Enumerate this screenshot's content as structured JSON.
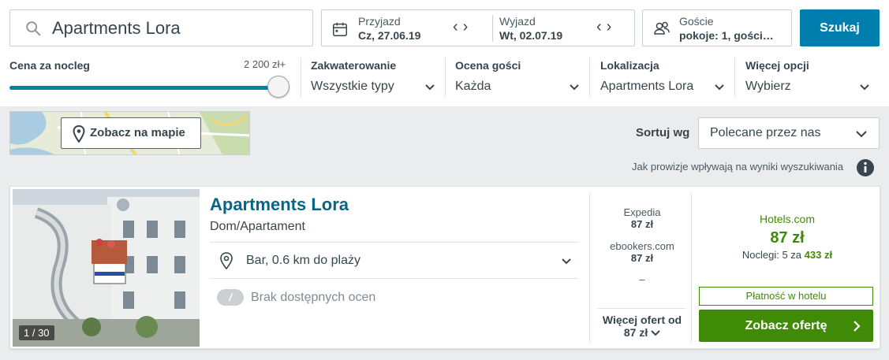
{
  "search": {
    "value": "Apartments Lora"
  },
  "dates": {
    "checkin_label": "Przyjazd",
    "checkin_value": "Cz, 27.06.19",
    "checkout_label": "Wyjazd",
    "checkout_value": "Wt, 02.07.19"
  },
  "guests": {
    "label": "Goście",
    "value": "pokoje: 1, gości…"
  },
  "search_button": "Szukaj",
  "filters": {
    "price": {
      "label": "Cena za nocleg",
      "max": "2 200 zł+",
      "level": 1.0
    },
    "accommodation": {
      "label": "Zakwaterowanie",
      "value": "Wszystkie typy"
    },
    "rating": {
      "label": "Ocena gości",
      "value": "Każda"
    },
    "location": {
      "label": "Lokalizacja",
      "value": "Apartments Lora"
    },
    "more": {
      "label": "Więcej opcji",
      "value": "Wybierz"
    }
  },
  "map": {
    "button": "Zobacz na mapie"
  },
  "sort": {
    "label": "Sortuj wg",
    "value": "Polecane przez nas"
  },
  "disclaimer": "Jak prowizje wpływają na wyniki wyszukiwania",
  "result": {
    "image_counter": "1 / 30",
    "name": "Apartments Lora",
    "type": "Dom/Apartament",
    "location": "Bar, 0.6 km do plaży",
    "rating_badge": "/",
    "rating_text": "Brak dostępnych ocen",
    "providers": [
      {
        "name": "Expedia",
        "price": "87 zł"
      },
      {
        "name": "ebookers.com",
        "price": "87 zł"
      }
    ],
    "placeholder_dash": "–",
    "more_offers_label": "Więcej ofert od",
    "more_offers_price": "87 zł",
    "deal": {
      "provider": "Hotels.com",
      "price": "87 zł",
      "nights_prefix": "Noclegi: 5 za",
      "nights_total": "433 zł",
      "pay_at_hotel": "Płatność w hotelu",
      "button": "Zobacz ofertę"
    }
  },
  "colors": {
    "accent_blue": "#007faf",
    "link_blue": "#0a6584",
    "deal_green": "#3f8a06"
  }
}
